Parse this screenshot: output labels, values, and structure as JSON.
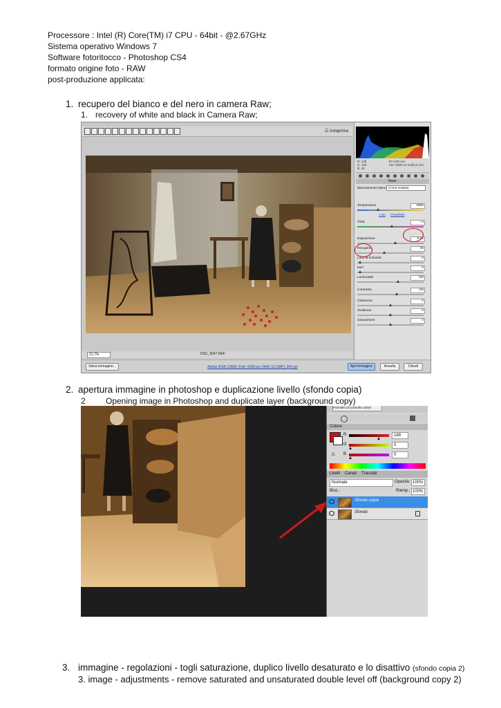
{
  "header": {
    "lines": [
      "Processore : Intel (R) Core(TM)  i7 CPU - 64bit - @2.67GHz",
      "Sistema operativo Windows 7",
      "Software fotoritocco - Photoshop  CS4",
      "formato origine foto - RAW",
      "post-produzione applicata:"
    ]
  },
  "steps": [
    {
      "num": "1.",
      "title": "recupero del bianco e del nero in camera Raw;",
      "sub_num": "1.",
      "sub_title": "recovery of white and black in Camera Raw;"
    },
    {
      "num": "2.",
      "title": "apertura immagine in photoshop e duplicazione livello (sfondo  copia)",
      "sub_num": "2",
      "sub_title": "Opening image in Photoshop and duplicate layer (background copy)"
    },
    {
      "num": "3.",
      "title": "immagine - regolazioni - togli saturazione, duplico livello desaturato e lo disattivo",
      "title_small": "(sfondo copia 2)",
      "sub_title": "3. image - adjustments - remove saturated and unsaturated double level off (background copy 2)"
    }
  ],
  "camera_raw": {
    "preview_label": "Anteprima",
    "zoom": "21,7%",
    "filename": "DSC_9047.NEF",
    "camera_info": [
      "R: 138",
      "f/4   1/30 sec",
      "G: 102",
      "ISO 1000   12-24@12 mm",
      "B: 40"
    ],
    "section_title": "Base",
    "white_balance_label": "Bilanciamento bianco:",
    "white_balance_value": "Come scattato",
    "links": [
      "Auto",
      "Predefiniti"
    ],
    "sliders": [
      {
        "label": "Temperatura",
        "value": "2900",
        "position": 0.3
      },
      {
        "label": "Tinta",
        "value": "+4",
        "position": 0.52
      },
      {
        "label": "Esposizione",
        "value": "0,65",
        "position": 0.58
      },
      {
        "label": "Recupero",
        "value": "40",
        "position": 0.4
      },
      {
        "label": "Luce di schiarita",
        "value": "0",
        "position": 0.02
      },
      {
        "label": "Neri",
        "value": "0",
        "position": 0.02
      },
      {
        "label": "Luminosità",
        "value": "+50",
        "position": 0.62
      },
      {
        "label": "Contrasto",
        "value": "+25",
        "position": 0.6
      },
      {
        "label": "Chiarezza",
        "value": "0",
        "position": 0.5
      },
      {
        "label": "Vividezza",
        "value": "0",
        "position": 0.5
      },
      {
        "label": "Saturazione",
        "value": "0",
        "position": 0.5
      }
    ],
    "save_button": "Salva immagine...",
    "workflow_link": "Adobe RGB (1998); 8 bit; 4288 per 2848 (12,2MP); 300 ppi",
    "open_button": "Apri immagine",
    "cancel_button": "Annulla",
    "done_button": "Chiudi",
    "colors": {
      "highlight": "#c4141a",
      "accent": "#4a77b6"
    }
  },
  "photoshop": {
    "top_field": "Pannello di controllo colore",
    "color_tab": "Colore",
    "channels": [
      {
        "label": "R",
        "value": "189",
        "position": 0.74,
        "gradient": "linear-gradient(90deg,#1a0000,#e02020)"
      },
      {
        "label": "G",
        "value": "0",
        "position": 0.0,
        "gradient": "linear-gradient(90deg,#bd0000,#bdff00)"
      },
      {
        "label": "B",
        "value": "0",
        "position": 0.0,
        "gradient": "linear-gradient(90deg,#bd0000,#bd00ff)"
      }
    ],
    "layer_tabs": [
      "Livelli",
      "Canali",
      "Tracciati"
    ],
    "blend_mode": "Normale",
    "opacity_label": "Opacità:",
    "opacity_value": "100%",
    "lock_label": "Bloc.:",
    "fill_label": "Riemp.:",
    "fill_value": "100%",
    "layers": [
      {
        "name": "Sfondo copia",
        "selected": true
      },
      {
        "name": "Sfondo",
        "selected": false
      }
    ],
    "colors": {
      "selected_layer": "#3a8ee6",
      "foreground": "#d01010",
      "arrow": "#cc1a1a"
    }
  }
}
